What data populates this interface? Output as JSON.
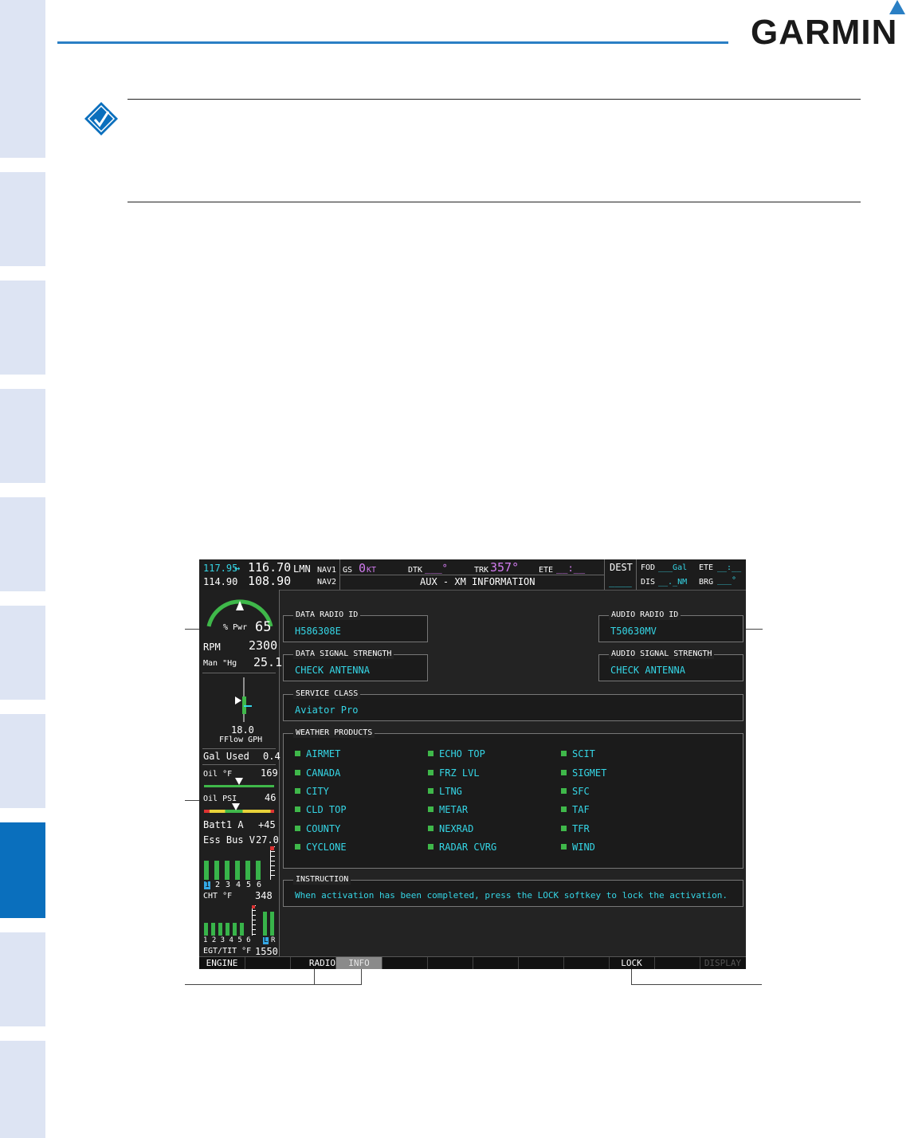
{
  "brand": {
    "name": "GARMIN",
    "accent": "#2a7fc4"
  },
  "side_tabs": {
    "active_index": 7
  },
  "screen": {
    "com": {
      "active_freq": "117.95",
      "standby_freq": "116.70",
      "arrow": "↔",
      "freq2": "114.90",
      "freq3": "108.90"
    },
    "nav": {
      "id": "LMN",
      "nav1": "NAV1",
      "nav2": "NAV2"
    },
    "nav_data": {
      "gs_label": "GS",
      "gs_value": "0",
      "gs_unit": "KT",
      "dtk_label": "DTK",
      "dtk_value": "___°",
      "trk_label": "TRK",
      "trk_value": "357°",
      "ete_label": "ETE",
      "ete_value": "__:__"
    },
    "page_title": "AUX - XM INFORMATION",
    "dest": {
      "label": "DEST",
      "value": "____",
      "fod_label": "FOD",
      "fod_value": "___Gal",
      "ete_label": "ETE",
      "ete_value": "__:__",
      "dis_label": "DIS",
      "dis_value": "__._NM",
      "brg_label": "BRG",
      "brg_value": "___°"
    },
    "engine": {
      "pwr_label": "% Pwr",
      "pwr_value": "65",
      "rpm_label": "RPM",
      "rpm_value": "2300",
      "man_label": "Man \"Hg",
      "man_value": "25.1",
      "fflow_value": "18.0",
      "fflow_label": "FFlow GPH",
      "gal_used_label": "Gal Used",
      "gal_used_value": "0.4",
      "oil_temp_label": "Oil °F",
      "oil_temp_value": "169",
      "oil_psi_label": "Oil PSI",
      "oil_psi_value": "46",
      "batt_label": "Batt1 A",
      "batt_value": "+45",
      "bus_label": "Ess Bus V",
      "bus_value": "27.0",
      "cht_cyl": [
        "1",
        "2",
        "3",
        "4",
        "5",
        "6"
      ],
      "cht_label": "CHT °F",
      "cht_value": "348",
      "egt_cyl": "1 2 3 4 5 6",
      "egt_lr": [
        "L",
        "R"
      ],
      "egt_label": "EGT/TIT °F",
      "egt_value": "1550"
    },
    "data_radio": {
      "label": "DATA RADIO ID",
      "value": "H586308E"
    },
    "audio_radio": {
      "label": "AUDIO RADIO ID",
      "value": "T50630MV"
    },
    "data_signal": {
      "label": "DATA SIGNAL STRENGTH",
      "value": "CHECK ANTENNA"
    },
    "audio_signal": {
      "label": "AUDIO SIGNAL STRENGTH",
      "value": "CHECK ANTENNA"
    },
    "service_class": {
      "label": "SERVICE CLASS",
      "value": "Aviator Pro"
    },
    "weather": {
      "label": "WEATHER PRODUCTS",
      "col1": [
        "AIRMET",
        "CANADA",
        "CITY",
        "CLD TOP",
        "COUNTY",
        "CYCLONE"
      ],
      "col2": [
        "ECHO TOP",
        "FRZ LVL",
        "LTNG",
        "METAR",
        "NEXRAD",
        "RADAR CVRG"
      ],
      "col3": [
        "SCIT",
        "SIGMET",
        "SFC",
        "TAF",
        "TFR",
        "WIND"
      ]
    },
    "instruction": {
      "label": "INSTRUCTION",
      "value": "When activation has been completed, press the LOCK softkey to lock the activation."
    },
    "softkeys": [
      "ENGINE",
      "",
      "RADIO",
      "INFO",
      "",
      "",
      "",
      "",
      "",
      "LOCK",
      "",
      "DISPLAY"
    ]
  }
}
